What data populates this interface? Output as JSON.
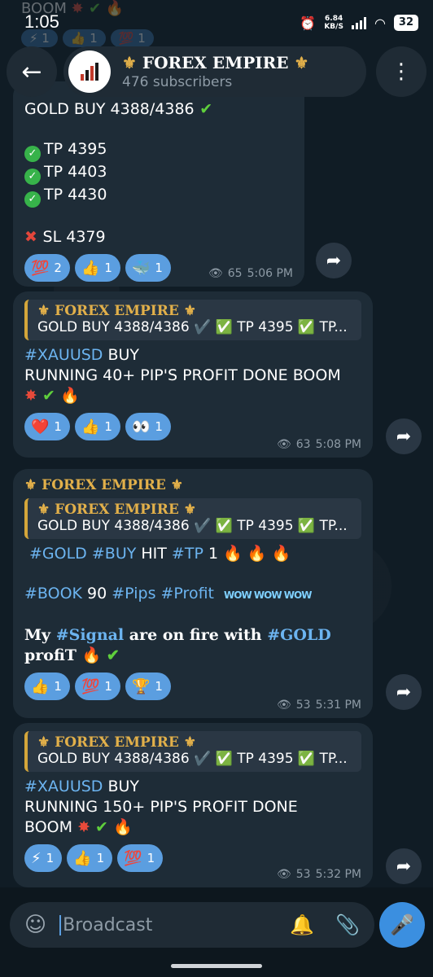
{
  "status": {
    "time": "1:05",
    "net_speed_value": "6.84",
    "net_speed_unit": "KB/S",
    "battery": "32"
  },
  "header": {
    "channel_name": "FOREX EMPIRE",
    "fleur": "⚜",
    "subscribers": "476 subscribers",
    "back_icon": "arrow-left-icon",
    "menu_icon": "more-vertical-icon"
  },
  "ghost_top": {
    "text": "BOOM",
    "reactions": [
      "⚡ 1",
      "👍 1",
      "💯 1"
    ]
  },
  "messages": [
    {
      "lines": [
        "GOLD BUY 4388/4386",
        "TP 4395",
        "TP 4403",
        "TP 4430",
        "SL 4379"
      ],
      "reactions": [
        {
          "emoji": "💯",
          "count": "2"
        },
        {
          "emoji": "👍",
          "count": "1"
        },
        {
          "emoji": "🐳",
          "count": "1"
        }
      ],
      "views": "65",
      "time": "5:06 PM"
    },
    {
      "reply_title": "FOREX EMPIRE",
      "reply_snippet": "GOLD BUY 4388/4386 ✔️ ✅ TP 4395 ✅ TP...",
      "hashtag": "#XAUUSD",
      "text1": " BUY",
      "text2": "RUNNING 40+ PIP'S PROFIT DONE BOOM",
      "reactions": [
        {
          "emoji": "❤️",
          "count": "1"
        },
        {
          "emoji": "👍",
          "count": "1"
        },
        {
          "emoji": "👀",
          "count": "1"
        }
      ],
      "views": "63",
      "time": "5:08 PM"
    },
    {
      "sender": "FOREX EMPIRE",
      "reply_title": "FOREX EMPIRE",
      "reply_snippet": "GOLD BUY 4388/4386 ✔️ ✅ TP 4395 ✅ TP...",
      "line1_tags": [
        "#GOLD",
        "#BUY"
      ],
      "line1_hit": " HIT ",
      "line1_tp": "#TP",
      "line1_num": " 1 ",
      "line2_book": "#BOOK",
      "line2_num": " 90 ",
      "line2_pips": "#Pips",
      "line2_profit": "#Profit",
      "wow": "WOW WOW WOW",
      "line3_a": "My ",
      "line3_signal": "#Signal",
      "line3_b": " are on fire with ",
      "line3_gold": "#GOLD",
      "line3_c": "profiT",
      "reactions": [
        {
          "emoji": "👍",
          "count": "1"
        },
        {
          "emoji": "💯",
          "count": "1"
        },
        {
          "emoji": "🏆",
          "count": "1"
        }
      ],
      "views": "53",
      "time": "5:31 PM"
    },
    {
      "reply_title": "FOREX EMPIRE",
      "reply_snippet": "GOLD BUY 4388/4386 ✔️ ✅ TP 4395 ✅ TP...",
      "hashtag": "#XAUUSD",
      "text1": " BUY",
      "text2": "RUNNING 150+ PIP'S PROFIT DONE",
      "text3": "BOOM",
      "reactions": [
        {
          "emoji": "⚡",
          "count": "1"
        },
        {
          "emoji": "👍",
          "count": "1"
        },
        {
          "emoji": "💯",
          "count": "1"
        }
      ],
      "views": "53",
      "time": "5:32 PM"
    }
  ],
  "input": {
    "placeholder": "Broadcast"
  },
  "colors": {
    "accent": "#5b9ee0",
    "gold": "#e2b04a",
    "bubble": "#1e2c37",
    "background": "#101c25"
  }
}
